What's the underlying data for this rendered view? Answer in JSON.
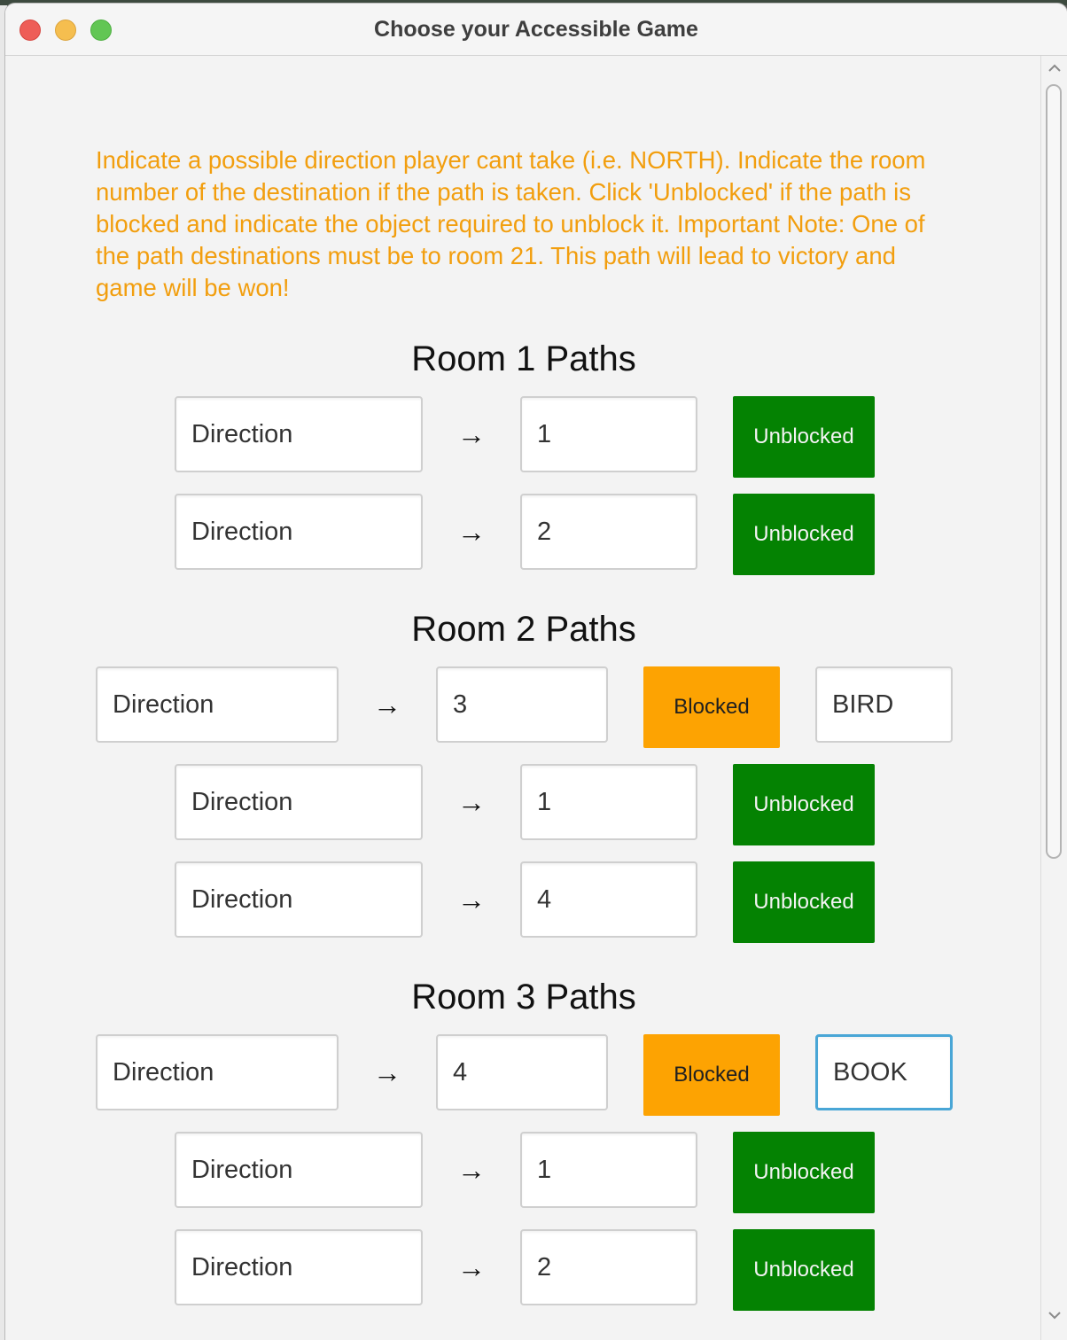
{
  "window": {
    "title": "Choose your Accessible Game"
  },
  "instructions": "Indicate a possible direction player cant take (i.e. NORTH). Indicate the room number of the destination if the path is taken. Click 'Unblocked' if the path is blocked and indicate the object required to unblock it. Important Note: One of the path destinations must be to room 21. This path will lead to victory and game will be won!",
  "arrow": "→",
  "rooms": [
    {
      "heading": "Room 1 Paths",
      "paths": [
        {
          "direction": "Direction",
          "destination": "1",
          "status": "Unblocked"
        },
        {
          "direction": "Direction",
          "destination": "2",
          "status": "Unblocked"
        }
      ]
    },
    {
      "heading": "Room 2 Paths",
      "paths": [
        {
          "direction": "Direction",
          "destination": "3",
          "status": "Blocked",
          "object": "BIRD"
        },
        {
          "direction": "Direction",
          "destination": "1",
          "status": "Unblocked"
        },
        {
          "direction": "Direction",
          "destination": "4",
          "status": "Unblocked"
        }
      ]
    },
    {
      "heading": "Room 3 Paths",
      "paths": [
        {
          "direction": "Direction",
          "destination": "4",
          "status": "Blocked",
          "object": "BOOK"
        },
        {
          "direction": "Direction",
          "destination": "1",
          "status": "Unblocked"
        },
        {
          "direction": "Direction",
          "destination": "2",
          "status": "Unblocked"
        }
      ]
    }
  ],
  "colors": {
    "instructions": "#f29e0e",
    "unblocked": "#048202",
    "blocked": "#fda302",
    "focus_ring": "#49a6d6"
  },
  "icons": {
    "close": "close-icon",
    "minimize": "minimize-icon",
    "maximize": "maximize-icon",
    "scroll_up": "chevron-up-icon",
    "scroll_down": "chevron-down-icon"
  }
}
